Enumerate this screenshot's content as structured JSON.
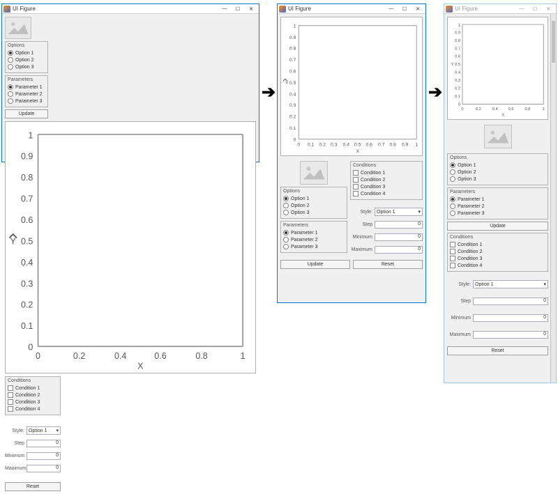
{
  "title": "UI Figure",
  "winbtns": {
    "min": "—",
    "max": "☐",
    "close": "✕"
  },
  "options": {
    "title": "Options",
    "items": [
      "Option 1",
      "Option 2",
      "Option 3"
    ],
    "selected": 0
  },
  "params": {
    "title": "Parameters",
    "items": [
      "Parameter 1",
      "Parameter 2",
      "Parameter 3"
    ],
    "selected": 0
  },
  "conds": {
    "title": "Conditions",
    "items": [
      "Condition 1",
      "Condition 2",
      "Condition 3",
      "Condition 4"
    ]
  },
  "form": {
    "style": {
      "label": "Style:",
      "value": "Option 1"
    },
    "step": {
      "label": "Step",
      "value": "0"
    },
    "min": {
      "label": "Minimum",
      "value": "0"
    },
    "max": {
      "label": "Maximum",
      "value": "0"
    }
  },
  "buttons": {
    "update": "Update",
    "reset": "Reset"
  },
  "plot": {
    "xlabel": "X",
    "ylabel": "Y",
    "xticks": [
      "0",
      "0.2",
      "0.4",
      "0.6",
      "0.8",
      "1"
    ],
    "yticks": [
      "0",
      "0.1",
      "0.2",
      "0.3",
      "0.4",
      "0.5",
      "0.6",
      "0.7",
      "0.8",
      "0.9",
      "1"
    ]
  },
  "chart_data": {
    "type": "line",
    "title": "",
    "xlabel": "X",
    "ylabel": "Y",
    "xlim": [
      0,
      1
    ],
    "ylim": [
      0,
      1
    ],
    "x": [],
    "y": []
  }
}
